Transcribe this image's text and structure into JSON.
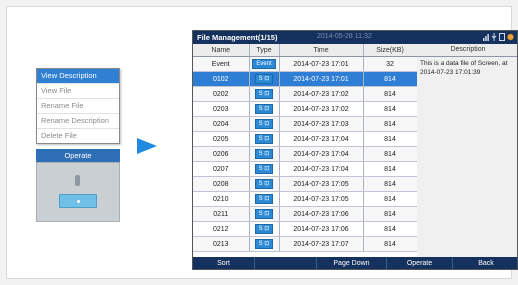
{
  "menu": {
    "items": [
      {
        "label": "View Description",
        "active": true
      },
      {
        "label": "View File",
        "active": false
      },
      {
        "label": "Rename File",
        "active": false
      },
      {
        "label": "Rename Description",
        "active": false
      },
      {
        "label": "Delete File",
        "active": false
      }
    ],
    "operate_label": "Operate"
  },
  "screen": {
    "title": "File Management(1/15)",
    "datetime": "2014-05-28 11:32",
    "columns": [
      "Name",
      "Type",
      "Time",
      "Size(KB)",
      "Description"
    ],
    "rows": [
      {
        "name": "Event",
        "type": "Event",
        "time": "2014-07-23 17:01",
        "size": "32",
        "selected": false
      },
      {
        "name": "0102",
        "type": "S ⊡",
        "time": "2014-07-23 17:01",
        "size": "814",
        "selected": true
      },
      {
        "name": "0202",
        "type": "S ⊡",
        "time": "2014-07-23 17:02",
        "size": "814",
        "selected": false
      },
      {
        "name": "0203",
        "type": "S ⊡",
        "time": "2014-07-23 17:02",
        "size": "814",
        "selected": false
      },
      {
        "name": "0204",
        "type": "S ⊡",
        "time": "2014-07-23 17:03",
        "size": "814",
        "selected": false
      },
      {
        "name": "0205",
        "type": "S ⊡",
        "time": "2014-07-23 17:04",
        "size": "814",
        "selected": false
      },
      {
        "name": "0206",
        "type": "S ⊡",
        "time": "2014-07-23 17:04",
        "size": "814",
        "selected": false
      },
      {
        "name": "0207",
        "type": "S ⊡",
        "time": "2014-07-23 17:04",
        "size": "814",
        "selected": false
      },
      {
        "name": "0208",
        "type": "S ⊡",
        "time": "2014-07-23 17:05",
        "size": "814",
        "selected": false
      },
      {
        "name": "0210",
        "type": "S ⊡",
        "time": "2014-07-23 17:05",
        "size": "814",
        "selected": false
      },
      {
        "name": "0211",
        "type": "S ⊡",
        "time": "2014-07-23 17:06",
        "size": "814",
        "selected": false
      },
      {
        "name": "0212",
        "type": "S ⊡",
        "time": "2014-07-23 17:06",
        "size": "814",
        "selected": false
      },
      {
        "name": "0213",
        "type": "S ⊡",
        "time": "2014-07-23 17:07",
        "size": "814",
        "selected": false
      }
    ],
    "description_text": "This is a data file of Screen, at 2014-07-23 17:01:39",
    "bottom_buttons": [
      "Sort",
      "",
      "Page Down",
      "Operate",
      "Back"
    ]
  },
  "colors": {
    "accent": "#2f7ed6",
    "title_bar": "#15325e",
    "arrow": "#1f8ae0"
  }
}
